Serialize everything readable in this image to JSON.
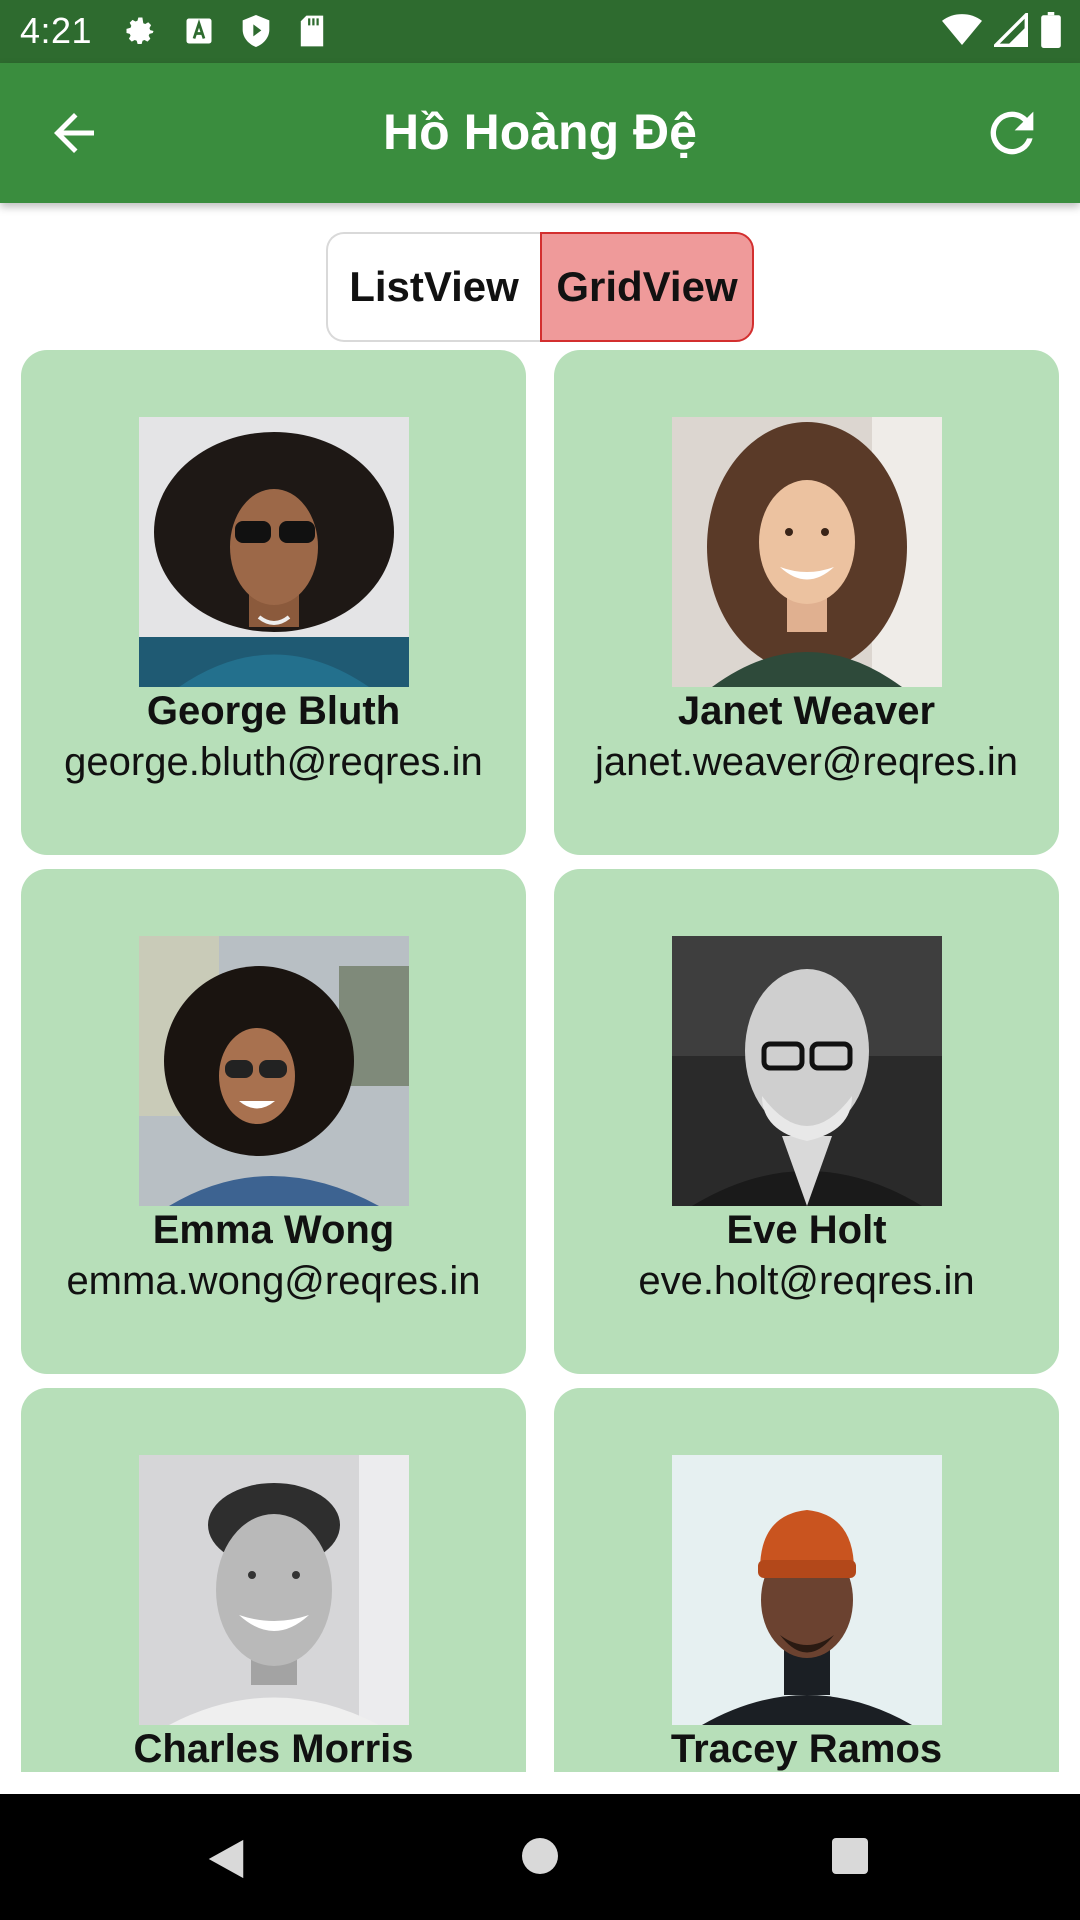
{
  "status_bar": {
    "time": "4:21",
    "left_icons": [
      "settings-icon",
      "font-a-icon",
      "shield-play-icon",
      "sd-card-icon"
    ],
    "right_icons": [
      "wifi-icon",
      "signal-icon",
      "battery-icon"
    ]
  },
  "app_bar": {
    "title": "Hồ Hoàng Đệ",
    "back_icon": "arrow-back-icon",
    "refresh_icon": "refresh-icon",
    "color": "#3a8d3e"
  },
  "segment": {
    "list_label": "ListView",
    "grid_label": "GridView",
    "selected": "GridView",
    "selected_color": "#ef9a9a"
  },
  "users": [
    {
      "name": "George Bluth",
      "email": "george.bluth@reqres.in"
    },
    {
      "name": "Janet Weaver",
      "email": "janet.weaver@reqres.in"
    },
    {
      "name": "Emma Wong",
      "email": "emma.wong@reqres.in"
    },
    {
      "name": "Eve Holt",
      "email": "eve.holt@reqres.in"
    },
    {
      "name": "Charles Morris",
      "email": ""
    },
    {
      "name": "Tracey Ramos",
      "email": ""
    }
  ],
  "colors": {
    "card_bg": "#b7dfb9",
    "status_bar": "#2e6b2f"
  }
}
